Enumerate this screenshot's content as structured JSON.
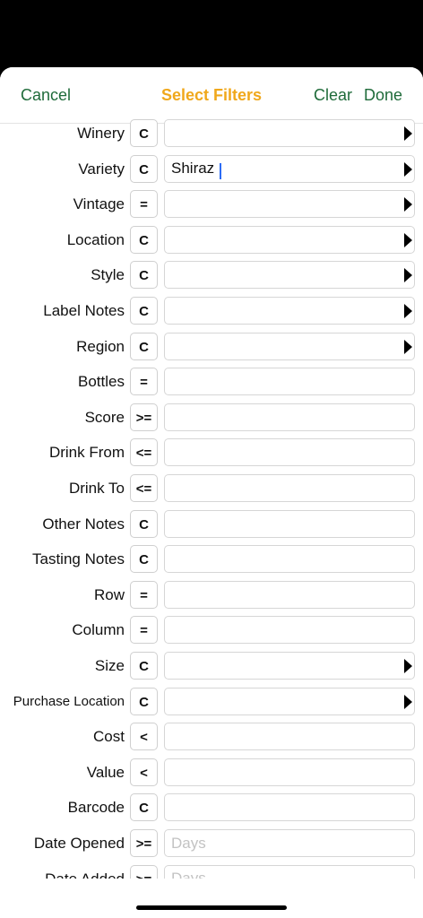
{
  "nav": {
    "cancel": "Cancel",
    "title": "Select Filters",
    "clear": "Clear",
    "done": "Done"
  },
  "rows": [
    {
      "label": "Winery",
      "op": "C",
      "value": "",
      "placeholder": "",
      "arrow": true
    },
    {
      "label": "Variety",
      "op": "C",
      "value": "Shiraz",
      "placeholder": "",
      "arrow": true
    },
    {
      "label": "Vintage",
      "op": "=",
      "value": "",
      "placeholder": "",
      "arrow": true
    },
    {
      "label": "Location",
      "op": "C",
      "value": "",
      "placeholder": "",
      "arrow": true
    },
    {
      "label": "Style",
      "op": "C",
      "value": "",
      "placeholder": "",
      "arrow": true
    },
    {
      "label": "Label Notes",
      "op": "C",
      "value": "",
      "placeholder": "",
      "arrow": true
    },
    {
      "label": "Region",
      "op": "C",
      "value": "",
      "placeholder": "",
      "arrow": true
    },
    {
      "label": "Bottles",
      "op": "=",
      "value": "",
      "placeholder": "",
      "arrow": false
    },
    {
      "label": "Score",
      "op": ">=",
      "value": "",
      "placeholder": "",
      "arrow": false
    },
    {
      "label": "Drink From",
      "op": "<=",
      "value": "",
      "placeholder": "",
      "arrow": false
    },
    {
      "label": "Drink To",
      "op": "<=",
      "value": "",
      "placeholder": "",
      "arrow": false
    },
    {
      "label": "Other Notes",
      "op": "C",
      "value": "",
      "placeholder": "",
      "arrow": false
    },
    {
      "label": "Tasting Notes",
      "op": "C",
      "value": "",
      "placeholder": "",
      "arrow": false
    },
    {
      "label": "Row",
      "op": "=",
      "value": "",
      "placeholder": "",
      "arrow": false
    },
    {
      "label": "Column",
      "op": "=",
      "value": "",
      "placeholder": "",
      "arrow": false
    },
    {
      "label": "Size",
      "op": "C",
      "value": "",
      "placeholder": "",
      "arrow": true
    },
    {
      "label": "Purchase Location",
      "op": "C",
      "value": "",
      "placeholder": "",
      "arrow": true
    },
    {
      "label": "Cost",
      "op": "<",
      "value": "",
      "placeholder": "",
      "arrow": false
    },
    {
      "label": "Value",
      "op": "<",
      "value": "",
      "placeholder": "",
      "arrow": false
    },
    {
      "label": "Barcode",
      "op": "C",
      "value": "",
      "placeholder": "",
      "arrow": false
    },
    {
      "label": "Date Opened",
      "op": ">=",
      "value": "",
      "placeholder": "Days",
      "arrow": false
    },
    {
      "label": "Date Added",
      "op": ">=",
      "value": "",
      "placeholder": "Days",
      "arrow": false
    }
  ]
}
